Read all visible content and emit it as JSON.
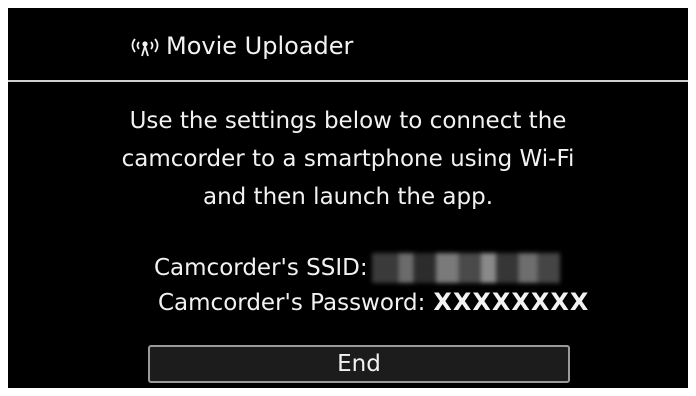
{
  "title_bar": {
    "icon": "wifi-antenna-icon",
    "title": "Movie Uploader"
  },
  "message": {
    "lines": [
      "Use the settings below to connect the",
      "camcorder to a smartphone using Wi-Fi",
      "and then launch the app."
    ]
  },
  "credentials": {
    "ssid_label": "Camcorder's SSID:",
    "password_label": "Camcorder's Password:",
    "password_value": "XXXXXXXX"
  },
  "buttons": {
    "end_label": "End"
  },
  "colors": {
    "background": "#000000",
    "text": "#f2f2f2",
    "divider": "#cfcfcf",
    "button_border": "#9a9a9a"
  }
}
